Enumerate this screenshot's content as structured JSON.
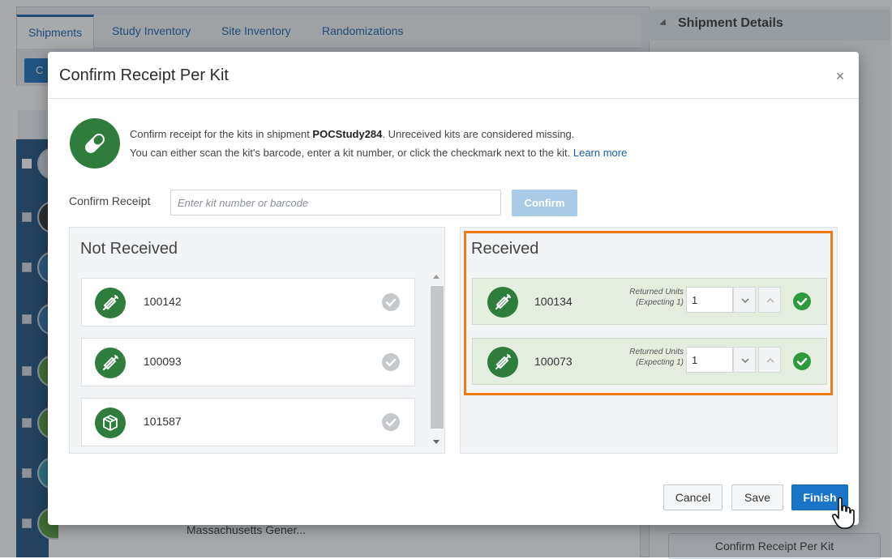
{
  "background": {
    "tabs": [
      {
        "label": "Shipments",
        "active": true
      },
      {
        "label": "Study Inventory",
        "active": false
      },
      {
        "label": "Site Inventory",
        "active": false
      },
      {
        "label": "Randomizations",
        "active": false
      }
    ],
    "toolbar_button_label": "C",
    "bottom_cell_text": "Massachusetts Gener...",
    "right_panel": {
      "title": "Shipment Details",
      "bottom_button_label": "Confirm Receipt Per Kit"
    }
  },
  "modal": {
    "title": "Confirm Receipt Per Kit",
    "close_label": "×",
    "info": {
      "line1_prefix": "Confirm receipt for the kits in shipment ",
      "shipment_id": "POCStudy284",
      "line1_suffix": ". Unreceived kits are considered missing.",
      "line2": "You can either scan the kit's barcode, enter a kit number, or click the checkmark next to the kit.",
      "learn_more": "Learn more"
    },
    "confirm_receipt": {
      "label": "Confirm Receipt",
      "placeholder": "Enter kit number or barcode",
      "button_label": "Confirm"
    },
    "not_received": {
      "title": "Not Received",
      "kits": [
        {
          "number": "100142",
          "icon": "syringe-icon"
        },
        {
          "number": "100093",
          "icon": "syringe-icon"
        },
        {
          "number": "101587",
          "icon": "box-icon"
        }
      ]
    },
    "received": {
      "title": "Received",
      "kits": [
        {
          "number": "100134",
          "units_label_line1": "Returned Units",
          "units_label_line2": "(Expecting 1)",
          "units_value": "1",
          "icon": "syringe-icon"
        },
        {
          "number": "100073",
          "units_label_line1": "Returned Units",
          "units_label_line2": "(Expecting 1)",
          "units_value": "1",
          "icon": "syringe-icon"
        }
      ]
    },
    "buttons": {
      "cancel": "Cancel",
      "save": "Save",
      "finish": "Finish"
    },
    "colors": {
      "accent": "#1a74c8",
      "kit_icon": "#2e7d3c",
      "highlight": "#f07a12",
      "received_row": "#e3eedf"
    }
  }
}
